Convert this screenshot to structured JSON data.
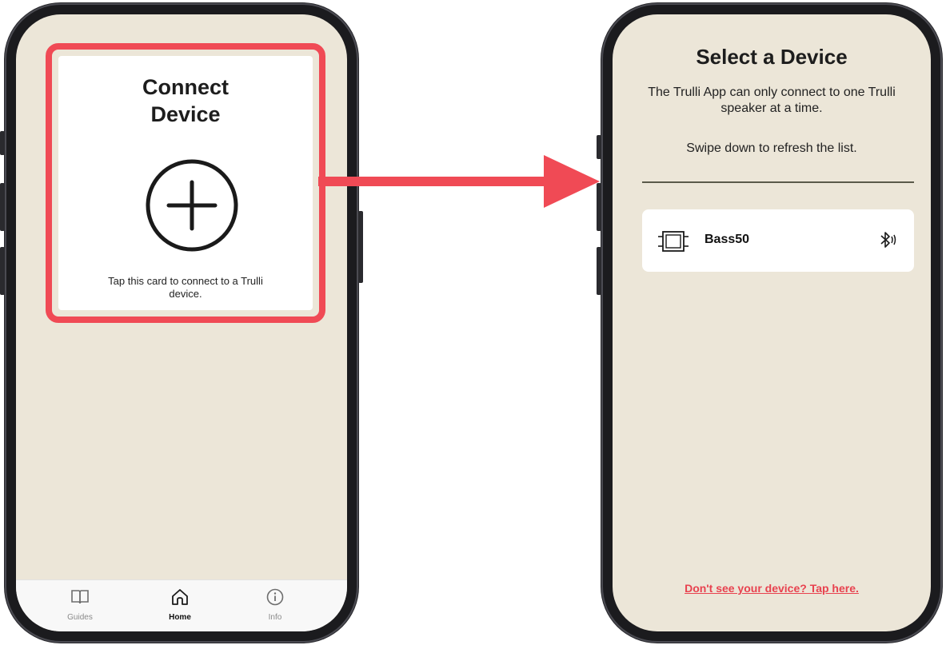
{
  "left_screen": {
    "card": {
      "title": "Connect Device",
      "hint": "Tap this card to connect to a Trulli device."
    },
    "tabbar": {
      "tabs": [
        {
          "label": "Guides",
          "icon": "book-icon",
          "active": false
        },
        {
          "label": "Home",
          "icon": "home-icon",
          "active": true
        },
        {
          "label": "Info",
          "icon": "info-icon",
          "active": false
        }
      ]
    }
  },
  "right_screen": {
    "title": "Select a Device",
    "description": "The Trulli App can only connect to one Trulli speaker at a time.",
    "swipe_hint": "Swipe down to refresh the list.",
    "devices": [
      {
        "name": "Bass50",
        "icon": "speaker-icon",
        "status_icon": "bluetooth-icon"
      }
    ],
    "help_link": "Don't see your device? Tap here."
  },
  "colors": {
    "accent": "#f04a55",
    "screen_background": "#ece6d8",
    "link": "#e8424f"
  }
}
